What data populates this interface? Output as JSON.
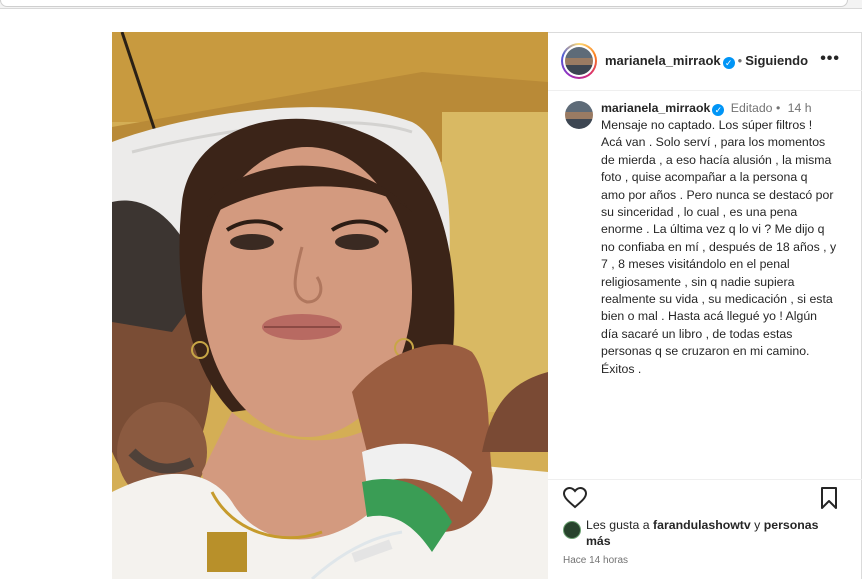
{
  "post": {
    "username": "marianela_mirraok",
    "separator": "•",
    "follow_status": "Siguiendo",
    "more_label": "•••",
    "caption": {
      "username": "marianela_mirraok",
      "edited": "Editado",
      "separator": "•",
      "time": "14 h",
      "text": "Mensaje no captado. Los súper filtros !\nAcá van . Solo serví , para los momentos\nde mierda , a eso hacía alusión , la misma\nfoto , quise acompañar a la persona q\namo por años . Pero nunca se destacó por\nsu sinceridad , lo cual , es una pena\nenorme . La última vez q lo vi ? Me dijo q\nno confiaba en mí , después de 18 años , y\n7 , 8 meses visitándolo en el penal\nreligiosamente , sin q nadie supiera\nrealmente su vida , su medicación , si esta\nbien o mal . Hasta acá llegué yo ! Algún\ndía sacaré un libro , de todas estas\npersonas q se cruzaron en mi camino.\nÉxitos ."
    },
    "likes": {
      "prefix": "Les gusta a",
      "user": "farandulashowtv",
      "conjunction": "y",
      "others": "personas más"
    },
    "posted_ago": "Hace 14 horas"
  },
  "icons": {
    "like": "heart-icon",
    "save": "bookmark-icon",
    "verified": "verified-badge-icon",
    "more": "more-options-icon"
  },
  "colors": {
    "link_blue": "#0095f6",
    "text": "#262626",
    "secondary": "#737373"
  }
}
